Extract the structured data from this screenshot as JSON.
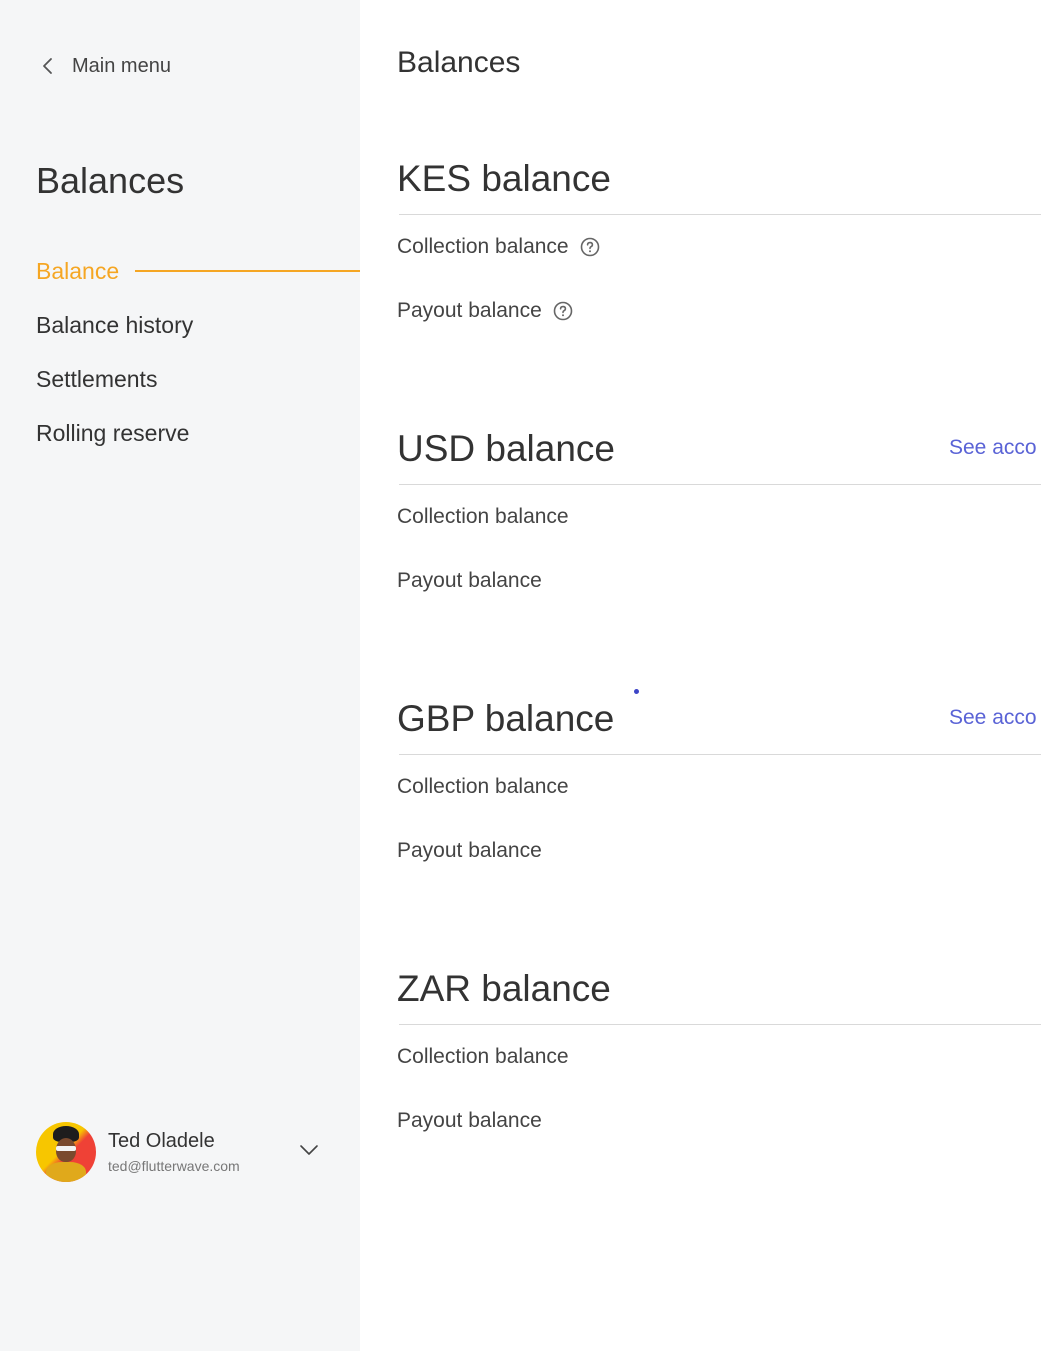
{
  "sidebar": {
    "back_label": "Main menu",
    "title": "Balances",
    "nav": [
      {
        "label": "Balance",
        "active": true
      },
      {
        "label": "Balance history",
        "active": false
      },
      {
        "label": "Settlements",
        "active": false
      },
      {
        "label": "Rolling reserve",
        "active": false
      }
    ],
    "user": {
      "name": "Ted Oladele",
      "email": "ted@flutterwave.com"
    }
  },
  "main": {
    "title": "Balances",
    "sections": [
      {
        "title": "KES balance",
        "link": "",
        "collection_label": "Collection balance",
        "payout_label": "Payout balance",
        "has_help_icons": true
      },
      {
        "title": "USD balance",
        "link": "See acco",
        "collection_label": "Collection balance",
        "payout_label": "Payout balance",
        "has_help_icons": false
      },
      {
        "title": "GBP balance",
        "link": "See acco",
        "collection_label": "Collection balance",
        "payout_label": "Payout balance",
        "has_help_icons": false
      },
      {
        "title": "ZAR balance",
        "link": "",
        "collection_label": "Collection balance",
        "payout_label": "Payout balance",
        "has_help_icons": false
      }
    ]
  },
  "colors": {
    "accent": "#f5a623",
    "link": "#5a63d6",
    "sidebar_bg": "#f5f6f7",
    "divider": "#d9d9d9"
  },
  "icons": [
    "chevron-left-icon",
    "help-circle-icon",
    "chevron-down-icon"
  ]
}
